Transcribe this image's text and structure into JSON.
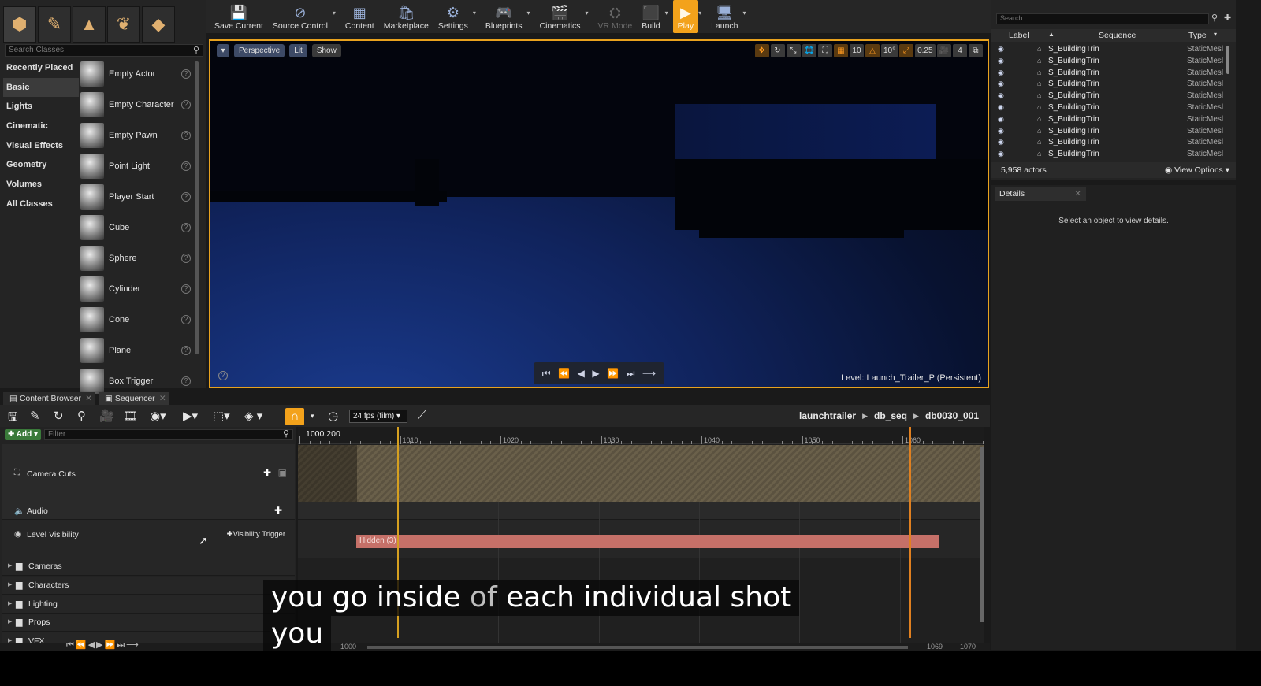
{
  "modes": {
    "tabs": [
      {
        "name": "place-mode",
        "glyph": "⬢"
      },
      {
        "name": "paint-mode",
        "glyph": "✎"
      },
      {
        "name": "landscape-mode",
        "glyph": "▲"
      },
      {
        "name": "foliage-mode",
        "glyph": "❦"
      },
      {
        "name": "geometry-mode",
        "glyph": "◆"
      }
    ],
    "search_placeholder": "Search Classes",
    "categories": [
      "Recently Placed",
      "Basic",
      "Lights",
      "Cinematic",
      "Visual Effects",
      "Geometry",
      "Volumes",
      "All Classes"
    ],
    "active_category": "Basic",
    "classes": [
      "Empty Actor",
      "Empty Character",
      "Empty Pawn",
      "Point Light",
      "Player Start",
      "Cube",
      "Sphere",
      "Cylinder",
      "Cone",
      "Plane",
      "Box Trigger"
    ]
  },
  "toolbar": {
    "buttons": [
      {
        "label": "Save Current",
        "icon": "save-icon",
        "glyph": "💾",
        "dropdown": false
      },
      {
        "label": "Source Control",
        "icon": "source-control-icon",
        "glyph": "⊘",
        "dropdown": true
      },
      {
        "label": "Content",
        "icon": "content-icon",
        "glyph": "▦",
        "dropdown": false
      },
      {
        "label": "Marketplace",
        "icon": "marketplace-icon",
        "glyph": "🛍",
        "dropdown": false
      },
      {
        "label": "Settings",
        "icon": "settings-icon",
        "glyph": "⚙",
        "dropdown": true
      },
      {
        "label": "Blueprints",
        "icon": "blueprints-icon",
        "glyph": "🎮",
        "dropdown": true
      },
      {
        "label": "Cinematics",
        "icon": "cinematics-icon",
        "glyph": "🎬",
        "dropdown": true
      },
      {
        "label": "VR Mode",
        "icon": "vr-mode-icon",
        "glyph": "⛭",
        "dropdown": false,
        "disabled": true
      },
      {
        "label": "Build",
        "icon": "build-icon",
        "glyph": "⬛",
        "dropdown": true
      },
      {
        "label": "Play",
        "icon": "play-icon",
        "glyph": "▶",
        "dropdown": true,
        "active": true
      },
      {
        "label": "Launch",
        "icon": "launch-icon",
        "glyph": "🖥",
        "dropdown": true
      }
    ]
  },
  "viewport": {
    "view_mode": "Perspective",
    "lighting": "Lit",
    "show": "Show",
    "grid_snap": "10",
    "rotation_snap": "10°",
    "scale_snap": "0.25",
    "camera_speed": "4",
    "level_label": "Level:",
    "level_name": "Launch_Trailer_P (Persistent)",
    "accent": "#e8a21e"
  },
  "outliner": {
    "search_placeholder": "Search...",
    "columns": {
      "label": "Label",
      "sequence": "Sequence",
      "type": "Type"
    },
    "rows": [
      {
        "label": "S_BuildingTrin",
        "type": "StaticMesl"
      },
      {
        "label": "S_BuildingTrin",
        "type": "StaticMesl"
      },
      {
        "label": "S_BuildingTrin",
        "type": "StaticMesl"
      },
      {
        "label": "S_BuildingTrin",
        "type": "StaticMesl"
      },
      {
        "label": "S_BuildingTrin",
        "type": "StaticMesl"
      },
      {
        "label": "S_BuildingTrin",
        "type": "StaticMesl"
      },
      {
        "label": "S_BuildingTrin",
        "type": "StaticMesl"
      },
      {
        "label": "S_BuildingTrin",
        "type": "StaticMesl"
      },
      {
        "label": "S_BuildingTrin",
        "type": "StaticMesl"
      },
      {
        "label": "S_BuildingTrin",
        "type": "StaticMesl"
      }
    ],
    "actor_count": "5,958 actors",
    "view_options": "View Options"
  },
  "details": {
    "tab": "Details",
    "empty_message": "Select an object to view details."
  },
  "bottom_tabs": [
    {
      "label": "Content Browser",
      "active": false
    },
    {
      "label": "Sequencer",
      "active": true
    }
  ],
  "sequencer": {
    "fps": "24 fps (film)",
    "breadcrumb": [
      "launchtrailer",
      "db_seq",
      "db0030_001"
    ],
    "add_label": "Add",
    "filter_placeholder": "Filter",
    "tracks": {
      "camera_cuts": "Camera Cuts",
      "audio": "Audio",
      "level_visibility": "Level Visibility",
      "visibility_trigger": "Visibility Trigger"
    },
    "folders": [
      "Cameras",
      "Characters",
      "Lighting",
      "Props",
      "VFX"
    ],
    "current_time": "1000.200",
    "ruler_ticks": [
      "1000",
      "1010",
      "1020",
      "1030",
      "1040",
      "1050",
      "1060"
    ],
    "hidden_section": "Hidden (3)",
    "range_start": "1000",
    "range_end_a": "1069",
    "range_end_b": "1070",
    "section_color": "#c57068",
    "marker_color": "#d6a020"
  },
  "caption": {
    "line1_a": "you go inside ",
    "line1_b": "of",
    "line1_c": " each individual shot",
    "line2": "you"
  }
}
